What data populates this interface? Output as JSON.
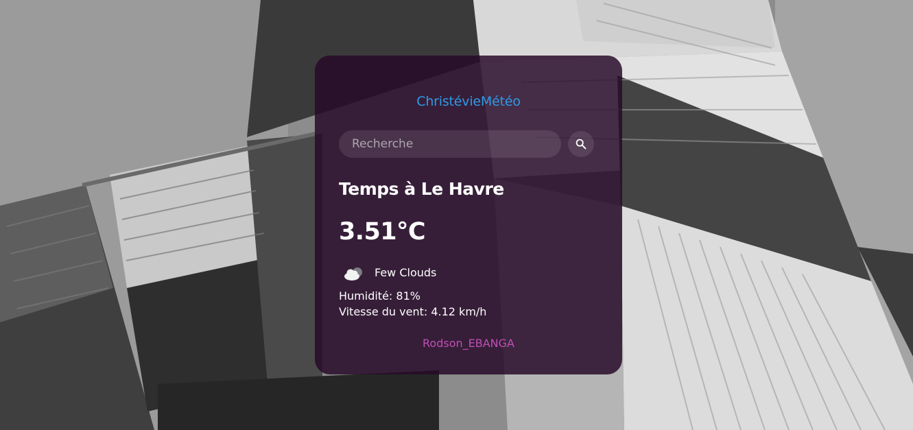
{
  "app": {
    "brand": "ChristévieMétéo",
    "author": "Rodson_EBANGA"
  },
  "search": {
    "placeholder": "Recherche",
    "value": ""
  },
  "weather": {
    "city_title": "Temps à Le Havre",
    "temperature": "3.51°C",
    "condition": "Few Clouds",
    "condition_icon": "few-clouds-icon",
    "humidity": "Humidité: 81%",
    "wind": "Vitesse du vent: 4.12 km/h"
  },
  "colors": {
    "brand": "#2f9be8",
    "author": "#c04fb4",
    "card": "#260a28"
  }
}
